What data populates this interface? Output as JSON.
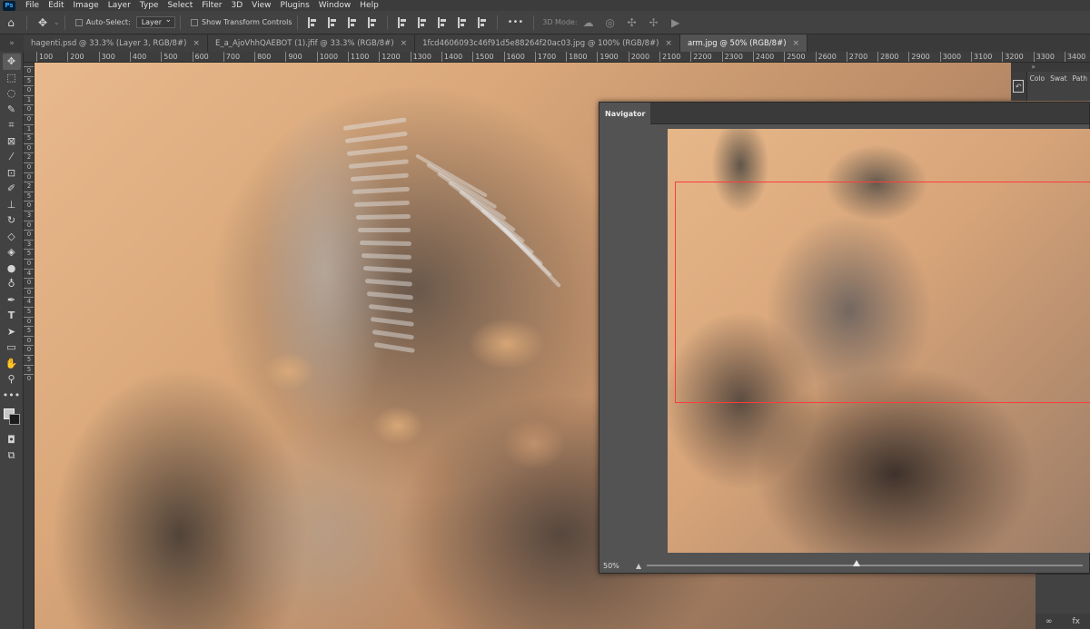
{
  "app": {
    "logo": "Ps"
  },
  "menu": [
    "File",
    "Edit",
    "Image",
    "Layer",
    "Type",
    "Select",
    "Filter",
    "3D",
    "View",
    "Plugins",
    "Window",
    "Help"
  ],
  "options_bar": {
    "auto_select_label": "Auto-Select:",
    "auto_select_value": "Layer",
    "show_transform_label": "Show Transform Controls",
    "more_label": "•••",
    "mode_3d_label": "3D Mode:"
  },
  "tabs": [
    {
      "label": "hagenti.psd @ 33.3% (Layer 3, RGB/8#)",
      "close": "×",
      "active": false
    },
    {
      "label": "E_a_AjoVhhQAEBOT (1).jfif @ 33.3% (RGB/8#)",
      "close": "×",
      "active": false
    },
    {
      "label": "1fcd4606093c46f91d5e88264f20ac03.jpg @ 100% (RGB/8#)",
      "close": "×",
      "active": false
    },
    {
      "label": "arm.jpg @ 50% (RGB/8#)",
      "close": "×",
      "active": true
    }
  ],
  "ruler_top": [
    "100",
    "200",
    "300",
    "400",
    "500",
    "600",
    "700",
    "800",
    "900",
    "1000",
    "1100",
    "1200",
    "1300",
    "1400",
    "1500",
    "1600",
    "1700",
    "1800",
    "1900",
    "2000",
    "2100",
    "2200",
    "2300",
    "2400",
    "2500",
    "2600",
    "2700",
    "2800",
    "2900",
    "3000",
    "3100",
    "3200",
    "3300",
    "3400"
  ],
  "ruler_left": [
    "0",
    "5",
    "0",
    "1",
    "0",
    "0",
    "1",
    "5",
    "0",
    "2",
    "0",
    "0",
    "2",
    "5",
    "0",
    "3",
    "0",
    "0",
    "3",
    "5",
    "0",
    "4",
    "0",
    "0",
    "4",
    "5",
    "0",
    "5",
    "0",
    "0",
    "5",
    "5",
    "0"
  ],
  "navigator": {
    "title": "Navigator",
    "zoom": "50%",
    "zoom_fraction": 0.48
  },
  "right_panels": {
    "collapse": "»",
    "tabs": [
      "Colo",
      "Swat",
      "Path"
    ],
    "history_icon": "history-icon",
    "bottom_icons": [
      "∞",
      "fx"
    ]
  },
  "colors": {
    "proxy": "#ff3b3b",
    "foreground": "#c8c8c8",
    "background": "#1c1c1c"
  }
}
